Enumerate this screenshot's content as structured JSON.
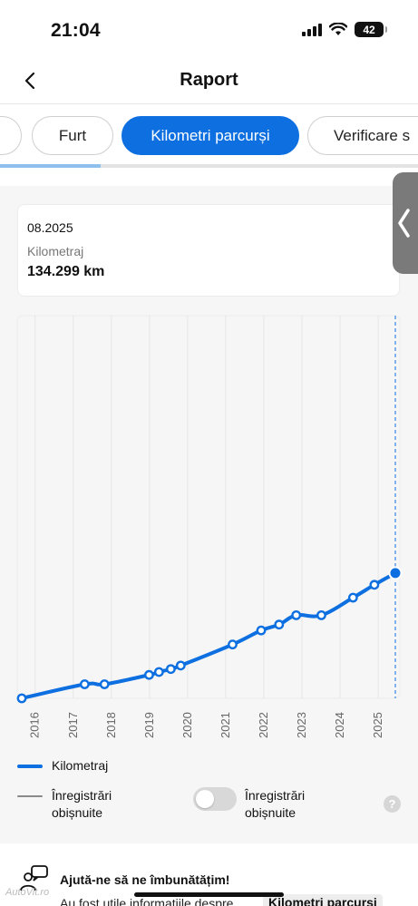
{
  "status_bar": {
    "time": "21:04",
    "battery": "42"
  },
  "header": {
    "title": "Raport",
    "back_icon": "chevron-left-icon"
  },
  "tabs": [
    {
      "label": "Furt",
      "active": false
    },
    {
      "label": "Kilometri parcurși",
      "active": true
    },
    {
      "label": "Verificare s",
      "active": false
    }
  ],
  "tab_progress": 0.24,
  "info_card": {
    "date": "08.2025",
    "label": "Kilometraj",
    "value": "134.299 km"
  },
  "chart_data": {
    "type": "line",
    "x_tick_labels": [
      "2016",
      "2017",
      "2018",
      "2019",
      "2020",
      "2021",
      "2022",
      "2023",
      "2024",
      "2025"
    ],
    "series": [
      {
        "name": "Kilometraj",
        "color": "#0d6fe0",
        "x": [
          2015.8,
          2017.45,
          2017.97,
          2019.14,
          2019.4,
          2019.71,
          2019.97,
          2021.33,
          2022.08,
          2022.55,
          2023.0,
          2023.66,
          2024.49,
          2025.05,
          2025.6
        ],
        "y": [
          0,
          12,
          12,
          20,
          22.5,
          25,
          28,
          46,
          58,
          63,
          71,
          71,
          86,
          97,
          107
        ],
        "highlighted_last": true
      }
    ],
    "y_unit": "thousand km (approx)",
    "ylim": [
      0,
      327
    ],
    "xlim": [
      2015.8,
      2025.6
    ],
    "grid": "vertical",
    "cursor_line": "dashed",
    "legend_position": "bottom"
  },
  "legend": {
    "series_label": "Kilometraj",
    "regular_records_label_line1": "Înregistrări",
    "regular_records_label_line2": "obișnuite",
    "toggle_label_line1": "Înregistrări",
    "toggle_label_line2": "obișnuite",
    "toggle_on": false,
    "help_label": "?"
  },
  "feedback": {
    "title": "Ajută-ne să ne îmbunătățim!",
    "text": "Au fost utile informațiile despre",
    "chip": "Kilometri parcurși"
  },
  "watermark": "AutoVit.ro",
  "colors": {
    "accent": "#0d6fe0",
    "chart_line": "#0d6fe0",
    "grid": "#e6e6e6"
  }
}
